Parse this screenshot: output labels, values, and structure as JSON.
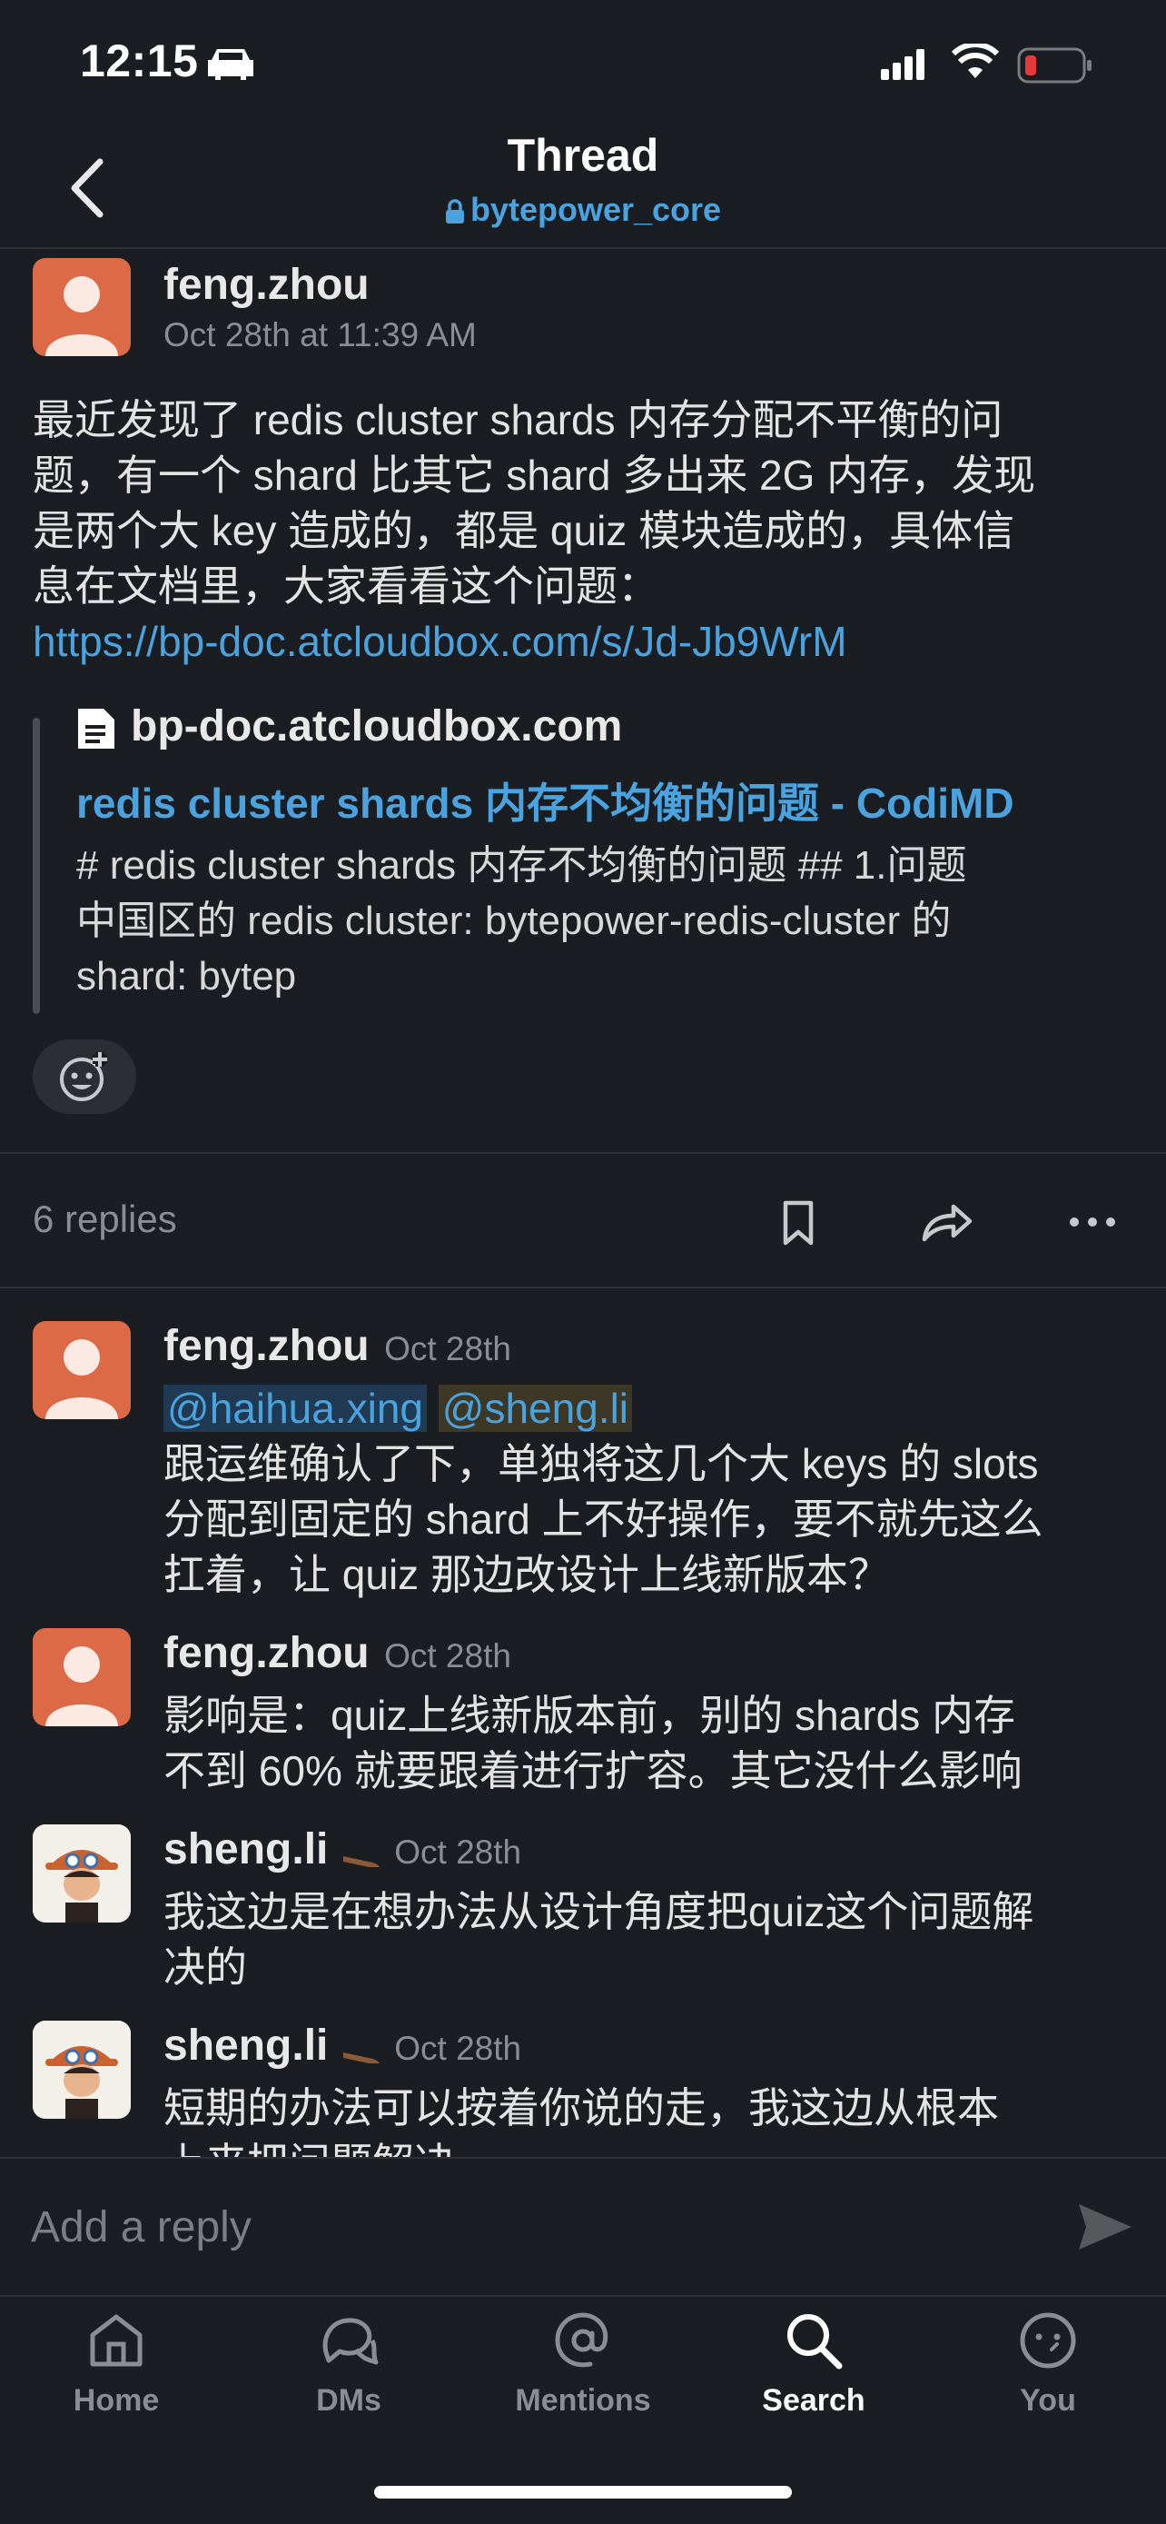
{
  "status_bar": {
    "time": "12:15"
  },
  "header": {
    "title": "Thread",
    "channel": "bytepower_core"
  },
  "parent": {
    "author": "feng.zhou",
    "timestamp": "Oct 28th at 11:39 AM",
    "lines": [
      "最近发现了 redis cluster shards 内存分配不平衡的问",
      "题，有一个 shard 比其它 shard 多出来 2G 内存，发现",
      "是两个大 key 造成的，都是 quiz 模块造成的，具体信",
      "息在文档里，大家看看这个问题："
    ],
    "link": "https://bp-doc.atcloudbox.com/s/Jd-Jb9WrM",
    "preview": {
      "domain": "bp-doc.atcloudbox.com",
      "title": "redis cluster shards 内存不均衡的问题 - CodiMD",
      "desc_lines": [
        "# redis cluster shards 内存不均衡的问题 ## 1.问题",
        "中国区的 redis cluster: bytepower-redis-cluster 的",
        "shard: bytep"
      ]
    }
  },
  "replies_bar": {
    "count_label": "6 replies"
  },
  "replies": [
    {
      "author": "feng.zhou",
      "timestamp": "Oct 28th",
      "mentions": [
        "@haihua.xing",
        "@sheng.li"
      ],
      "lines": [
        "跟运维确认了下，单独将这几个大 keys 的 slots",
        "分配到固定的 shard 上不好操作，要不就先这么",
        "扛着，让 quiz 那边改设计上线新版本？"
      ]
    },
    {
      "author": "feng.zhou",
      "timestamp": "Oct 28th",
      "lines": [
        "影响是：quiz上线新版本前，别的 shards 内存",
        "不到 60% 就要跟着进行扩容。其它没什么影响"
      ]
    },
    {
      "author": "sheng.li",
      "timestamp": "Oct 28th",
      "lines": [
        "我这边是在想办法从设计角度把quiz这个问题解",
        "决的"
      ]
    },
    {
      "author": "sheng.li",
      "timestamp": "Oct 28th",
      "lines": [
        "短期的办法可以按着你说的走，我这边从根本",
        "上来把问题解决"
      ]
    }
  ],
  "composer": {
    "placeholder": "Add a reply"
  },
  "tabs": [
    {
      "label": "Home",
      "icon": "home-icon"
    },
    {
      "label": "DMs",
      "icon": "dms-icon"
    },
    {
      "label": "Mentions",
      "icon": "mentions-icon"
    },
    {
      "label": "Search",
      "icon": "search-icon",
      "active": true
    },
    {
      "label": "You",
      "icon": "you-icon"
    }
  ],
  "colors": {
    "background": "#1a1d21",
    "link": "#4aa3df",
    "avatar": "#dd6a47"
  }
}
